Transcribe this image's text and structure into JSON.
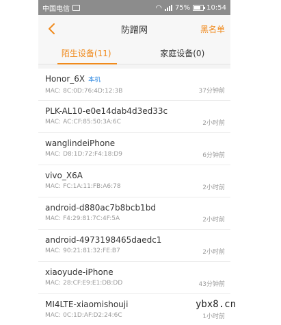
{
  "status": {
    "carrier": "中国电信",
    "battery": "75%",
    "battery_level": 0.75,
    "time": "10:54"
  },
  "navbar": {
    "title": "防蹭网",
    "blacklist": "黑名单"
  },
  "tabs": [
    {
      "label": "陌生设备(11)",
      "active": true
    },
    {
      "label": "家庭设备(0)",
      "active": false
    }
  ],
  "mac_label": "MAC:",
  "devices": [
    {
      "name": "Honor_6X",
      "tag": "本机",
      "mac": "8C:0D:76:4D:12:3B",
      "time": "37分钟前"
    },
    {
      "name": "PLK-AL10-e0e14dab4d3ed33c",
      "mac": "AC:CF:85:50:3A:6C",
      "time": "2小时前"
    },
    {
      "name": "wanglindeiPhone",
      "mac": "D8:1D:72:F4:18:D9",
      "time": "6分钟前"
    },
    {
      "name": "vivo_X6A",
      "mac": "FC:1A:11:FB:A6:78",
      "time": "2小时前"
    },
    {
      "name": "android-d880ac7b8bcb1bd",
      "mac": "F4:29:81:7C:4F:5A",
      "time": "2小时前"
    },
    {
      "name": "android-4973198465daedc1",
      "mac": "90:21:81:32:FE:B7",
      "time": "2小时前"
    },
    {
      "name": "xiaoyude-iPhone",
      "mac": "28:CF:E9:E1:DB:DD",
      "time": "43分钟前"
    },
    {
      "name": "MI4LTE-xiaomishouji",
      "mac": "0C:1D:AF:D2:24:6C",
      "time": "1小时前"
    }
  ],
  "watermark": "ybx8.cn",
  "colors": {
    "accent": "#f08a1c",
    "link": "#2a86e0"
  }
}
